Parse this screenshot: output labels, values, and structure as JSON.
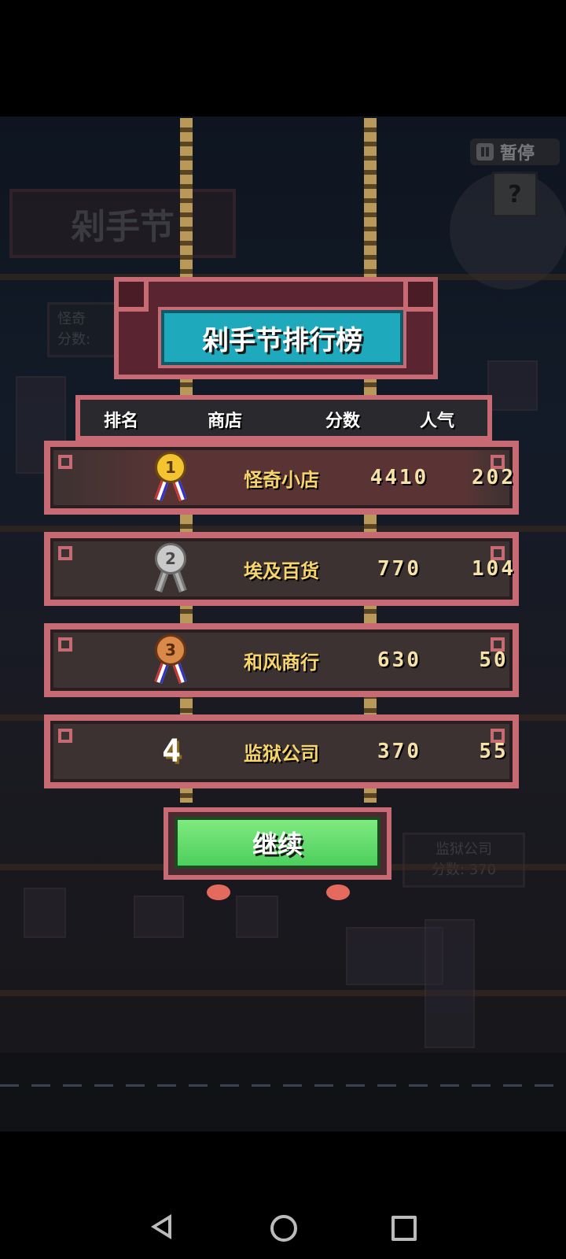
{
  "background": {
    "sign_title": "剁手节",
    "shop_card_left": {
      "name": "怪奇",
      "score_label": "分数:"
    },
    "shop_card_right": {
      "name": "监狱公司",
      "score_label": "分数: 370"
    },
    "pause_label": "暂停",
    "help_label": "?"
  },
  "leaderboard": {
    "title": "剁手节排行榜",
    "headers": {
      "rank": "排名",
      "shop": "商店",
      "score": "分数",
      "popularity": "人气"
    },
    "rows": [
      {
        "rank": "1",
        "shop": "怪奇小店",
        "score": "4410",
        "popularity": "202",
        "medal": "gold"
      },
      {
        "rank": "2",
        "shop": "埃及百货",
        "score": "770",
        "popularity": "104",
        "medal": "silver"
      },
      {
        "rank": "3",
        "shop": "和风商行",
        "score": "630",
        "popularity": "50",
        "medal": "bronze"
      },
      {
        "rank": "4",
        "shop": "监狱公司",
        "score": "370",
        "popularity": "55",
        "medal": "none"
      }
    ],
    "continue_label": "继续"
  },
  "colors": {
    "frame": "#c86a74",
    "title_panel": "#1fa9bd",
    "continue": "#5cd86a",
    "gold_text": "#f8d56a"
  },
  "navbar": {
    "icons": [
      "back-icon",
      "home-icon",
      "recent-apps-icon"
    ]
  }
}
